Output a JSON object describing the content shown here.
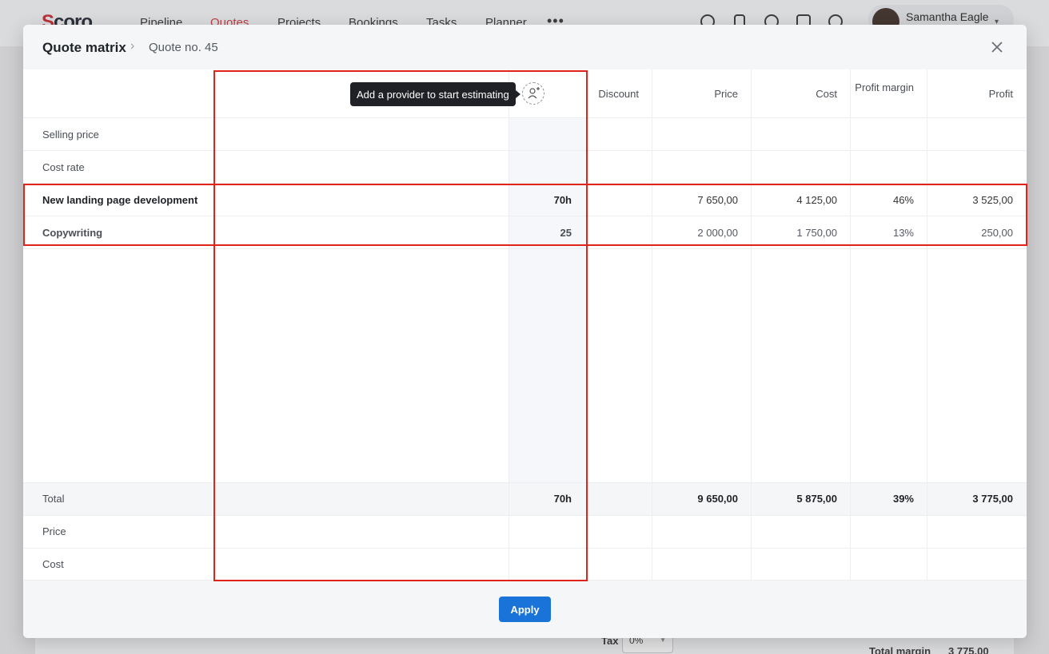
{
  "background": {
    "logo": "Scoro",
    "nav": [
      {
        "label": "Pipeline",
        "active": false
      },
      {
        "label": "Quotes",
        "active": true
      },
      {
        "label": "Projects",
        "active": false
      },
      {
        "label": "Bookings",
        "active": false
      },
      {
        "label": "Tasks",
        "active": false
      },
      {
        "label": "Planner",
        "active": false
      }
    ],
    "more_icon": "ellipsis-icon",
    "toolbar_icons": [
      "timer-icon",
      "mobile-icon",
      "search-icon",
      "add-icon",
      "help-icon"
    ],
    "user_name": "Samantha Eagle",
    "tax_label": "Tax",
    "tax_value": "0%",
    "total_margin_label": "Total margin",
    "total_margin_value": "3 775,00"
  },
  "modal": {
    "title": "Quote matrix",
    "breadcrumb": "Quote no. 45",
    "close_icon": "close-icon",
    "tooltip": "Add a provider to start estimating",
    "add_provider_icon": "add-person-icon",
    "columns": {
      "discount": "Discount",
      "price": "Price",
      "cost": "Cost",
      "profit_margin": "Profit margin",
      "profit": "Profit"
    },
    "rows": {
      "selling_price": "Selling price",
      "cost_rate": "Cost rate"
    },
    "items": [
      {
        "name": "New landing page development",
        "qty": "70h",
        "discount": "",
        "price": "7 650,00",
        "cost": "4 125,00",
        "margin": "46%",
        "profit": "3 525,00"
      },
      {
        "name": "Copywriting",
        "qty": "25",
        "discount": "",
        "price": "2 000,00",
        "cost": "1 750,00",
        "margin": "13%",
        "profit": "250,00"
      }
    ],
    "total": {
      "label": "Total",
      "qty": "70h",
      "price": "9 650,00",
      "cost": "5 875,00",
      "margin": "39%",
      "profit": "3 775,00"
    },
    "footer_rows": {
      "price": "Price",
      "cost": "Cost"
    },
    "apply_label": "Apply"
  },
  "colors": {
    "accent": "#1a73d9",
    "brand_red": "#d2333b",
    "annotation": "#e2231a"
  }
}
